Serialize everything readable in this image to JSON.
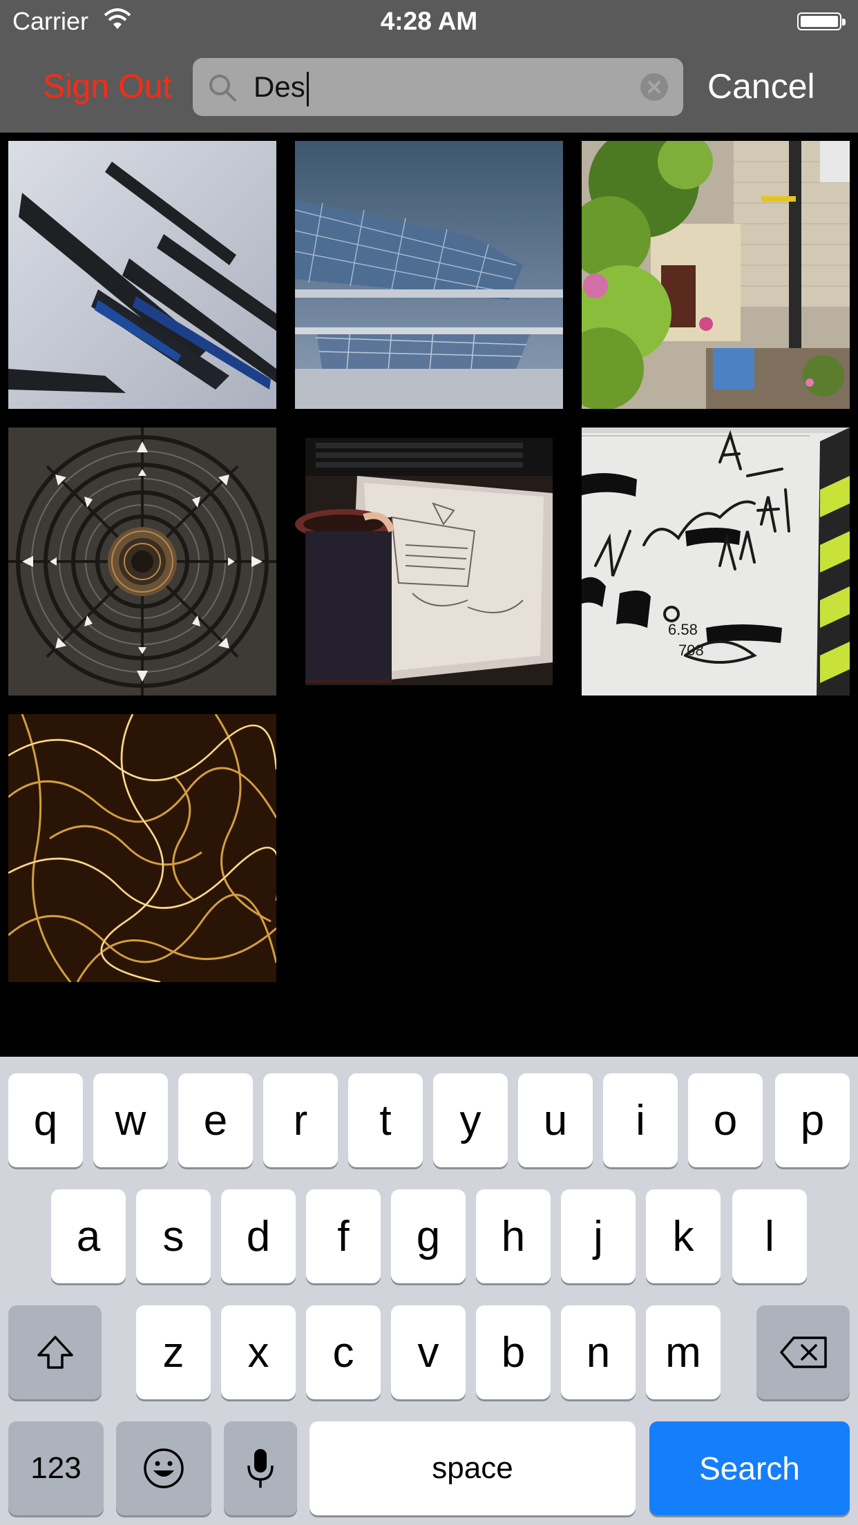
{
  "status_bar": {
    "carrier": "Carrier",
    "time": "4:28 AM"
  },
  "nav": {
    "sign_out_label": "Sign Out",
    "search_query": "Des",
    "cancel_label": "Cancel"
  },
  "colors": {
    "sign_out": "#ff2a14",
    "search_key": "#157efb",
    "bar_background": "#5a5a5a"
  },
  "photos": [
    {
      "name": "photo-abstract-architecture"
    },
    {
      "name": "photo-glass-building"
    },
    {
      "name": "photo-house-with-flowers"
    },
    {
      "name": "photo-dome-ceiling"
    },
    {
      "name": "photo-sketch-and-mug"
    },
    {
      "name": "photo-handwritten-notes"
    },
    {
      "name": "photo-light-trails"
    }
  ],
  "keyboard": {
    "row1": [
      "q",
      "w",
      "e",
      "r",
      "t",
      "y",
      "u",
      "i",
      "o",
      "p"
    ],
    "row2": [
      "a",
      "s",
      "d",
      "f",
      "g",
      "h",
      "j",
      "k",
      "l"
    ],
    "row3": [
      "z",
      "x",
      "c",
      "v",
      "b",
      "n",
      "m"
    ],
    "numbers_label": "123",
    "space_label": "space",
    "search_label": "Search"
  }
}
